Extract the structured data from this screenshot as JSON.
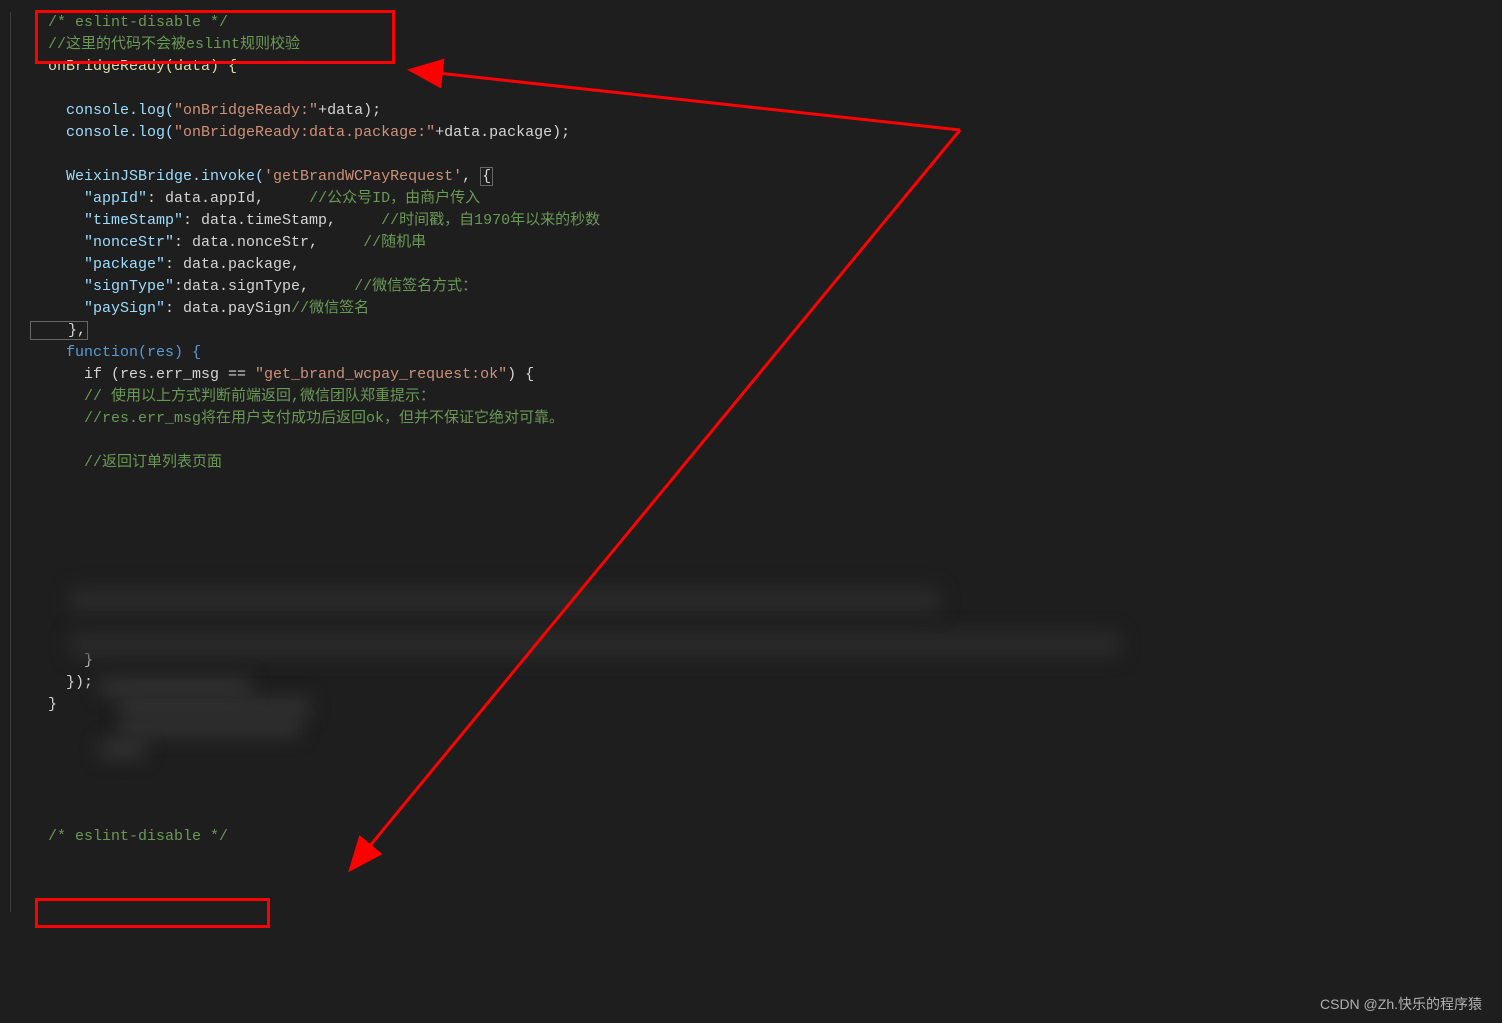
{
  "code": {
    "line1": "  /* eslint-disable */",
    "line2": "  //这里的代码不会被eslint规则校验",
    "line3": "  onBridgeReady(data) {",
    "line4": "",
    "line5_a": "    console.log(",
    "line5_b": "\"onBridgeReady:\"",
    "line5_c": "+data);",
    "line6_a": "    console.log(",
    "line6_b": "\"onBridgeReady:data.package:\"",
    "line6_c": "+data.package);",
    "line7": "",
    "line8_a": "    WeixinJSBridge.invoke(",
    "line8_b": "'getBrandWCPayRequest'",
    "line8_c": ", ",
    "line8_d": "{",
    "line9_a": "      \"appId\"",
    "line9_b": ": data.appId,     ",
    "line9_c": "//公众号ID，由商户传入",
    "line10_a": "      \"timeStamp\"",
    "line10_b": ": data.timeStamp,     ",
    "line10_c": "//时间戳，自1970年以来的秒数",
    "line11_a": "      \"nonceStr\"",
    "line11_b": ": data.nonceStr,     ",
    "line11_c": "//随机串",
    "line12_a": "      \"package\"",
    "line12_b": ": data.package,",
    "line13_a": "      \"signType\"",
    "line13_b": ":data.signType,     ",
    "line13_c": "//微信签名方式：",
    "line14_a": "      \"paySign\"",
    "line14_b": ": data.paySign",
    "line14_c": "//微信签名",
    "line15": "    },",
    "line16": "    function(res) {",
    "line17_a": "      if (res.err_msg == ",
    "line17_b": "\"get_brand_wcpay_request:ok\"",
    "line17_c": ") {",
    "line18": "      // 使用以上方式判断前端返回,微信团队郑重提示：",
    "line19": "      //res.err_msg将在用户支付成功后返回ok，但并不保证它绝对可靠。",
    "line20": "",
    "line21": "      //返回订单列表页面",
    "line22": "",
    "line23": "",
    "line24": "",
    "line25": "",
    "line26": "",
    "line27": "",
    "line28": "",
    "line29": "",
    "line30": "      }",
    "line31": "    });",
    "line32": "  }",
    "line33": "  /* eslint-disable */"
  },
  "watermark": "CSDN @Zh.快乐的程序猿"
}
